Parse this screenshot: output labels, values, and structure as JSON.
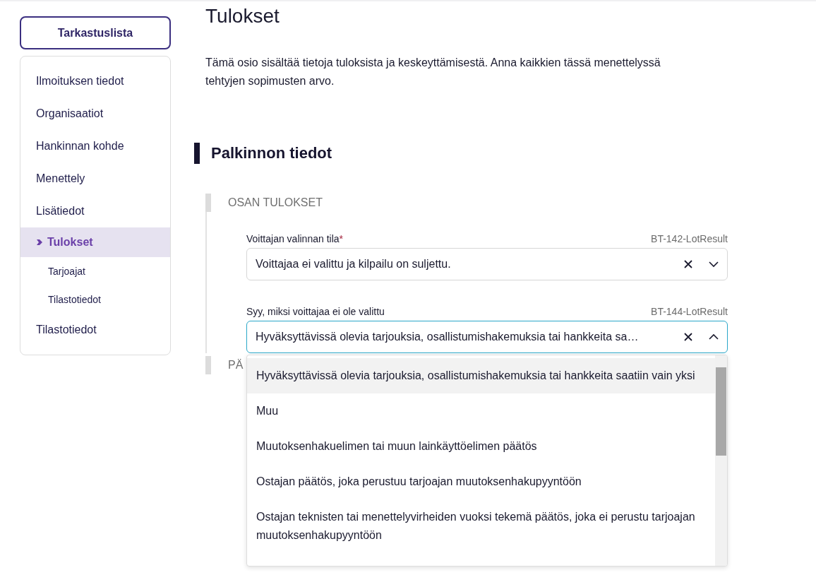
{
  "sidebar": {
    "checklist_button": "Tarkastuslista",
    "items": [
      {
        "label": "Ilmoituksen tiedot",
        "selected": false
      },
      {
        "label": "Organisaatiot",
        "selected": false
      },
      {
        "label": "Hankinnan kohde",
        "selected": false
      },
      {
        "label": "Menettely",
        "selected": false
      },
      {
        "label": "Lisätiedot",
        "selected": false
      },
      {
        "label": "Tulokset",
        "selected": true,
        "children": [
          {
            "label": "Tarjoajat",
            "selected": false
          },
          {
            "label": "Tilastotiedot",
            "selected": false
          }
        ]
      },
      {
        "label": "Tilastotiedot",
        "selected": false
      }
    ]
  },
  "main": {
    "title": "Tulokset",
    "intro": "Tämä osio sisältää tietoja tuloksista ja keskeyttämisestä. Anna kaikkien tässä menettelyssä tehtyjen sopimusten arvo.",
    "section": {
      "heading": "Palkinnon tiedot",
      "subsections": [
        {
          "heading": "OSAN TULOKSET",
          "fields": [
            {
              "label": "Voittajan valinnan tila",
              "required_mark": "*",
              "code": "BT-142-LotResult",
              "value": "Voittajaa ei valittu ja kilpailu on suljettu.",
              "expanded": false
            },
            {
              "label": "Syy, miksi voittajaa ei ole valittu",
              "code": "BT-144-LotResult",
              "value": "Hyväksyttävissä olevia tarjouksia, osallistumishakemuksia tai hankkeita sa…",
              "expanded": true,
              "options": [
                {
                  "label": "Hyväksyttävissä olevia tarjouksia, osallistumishakemuksia tai hankkeita saatiin vain yksi",
                  "highlighted": true
                },
                {
                  "label": "Muu",
                  "highlighted": false
                },
                {
                  "label": "Muutoksenhakuelimen tai muun lainkäyttöelimen päätös",
                  "highlighted": false
                },
                {
                  "label": "Ostajan päätös, joka perustuu tarjoajan muutoksenhakupyyntöön",
                  "highlighted": false
                },
                {
                  "label": "Ostajan teknisten tai menettelyvirheiden vuoksi tekemä päätös, joka ei perustu tarjoajan muutoksenhakupyyntöön",
                  "highlighted": false
                }
              ]
            }
          ]
        },
        {
          "heading": "PÄ"
        }
      ]
    }
  }
}
